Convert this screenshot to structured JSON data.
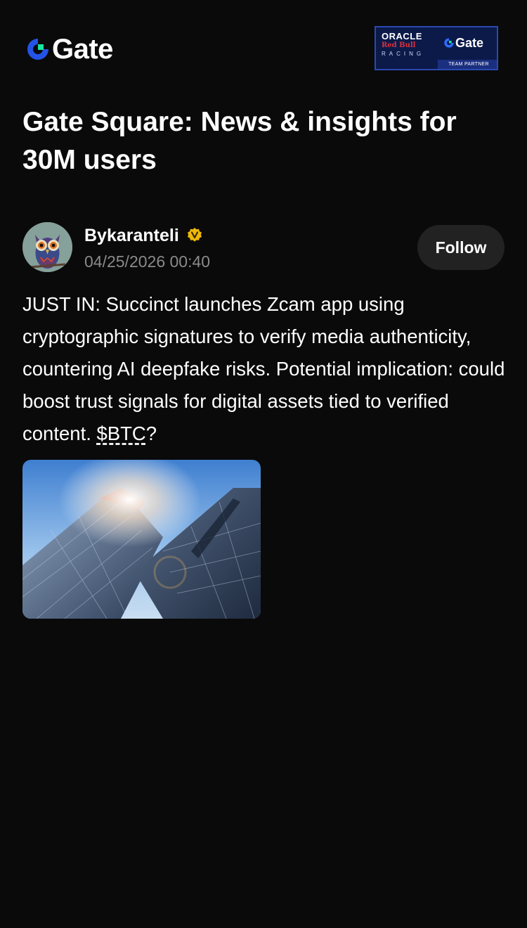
{
  "header": {
    "logo_text": "Gate",
    "partner_badge": {
      "oracle": "ORACLE",
      "redbull": "Red Bull",
      "racing": "RACING",
      "gate_text": "Gate",
      "partner_label": "TEAM PARTNER"
    }
  },
  "page": {
    "title": "Gate Square: News & insights for 30M users"
  },
  "post": {
    "author": "Bykaranteli",
    "date": "04/25/2026 00:40",
    "follow_label": "Follow",
    "body_text": "JUST IN: Succinct launches Zcam app using cryptographic signatures to verify media authenticity, countering AI deepfake risks. Potential implication: could boost trust signals for digital assets tied to verified content. ",
    "ticker": "$BTC",
    "body_suffix": "?"
  },
  "colors": {
    "background": "#0a0a0a",
    "brand_blue": "#2354e6",
    "brand_green": "#17e6a1",
    "verified_gold": "#f0b90b",
    "muted_text": "#8a8a8a",
    "button_bg": "#222222"
  },
  "icons": {
    "logo": "gate-logo-icon",
    "verified": "verified-badge-icon"
  }
}
